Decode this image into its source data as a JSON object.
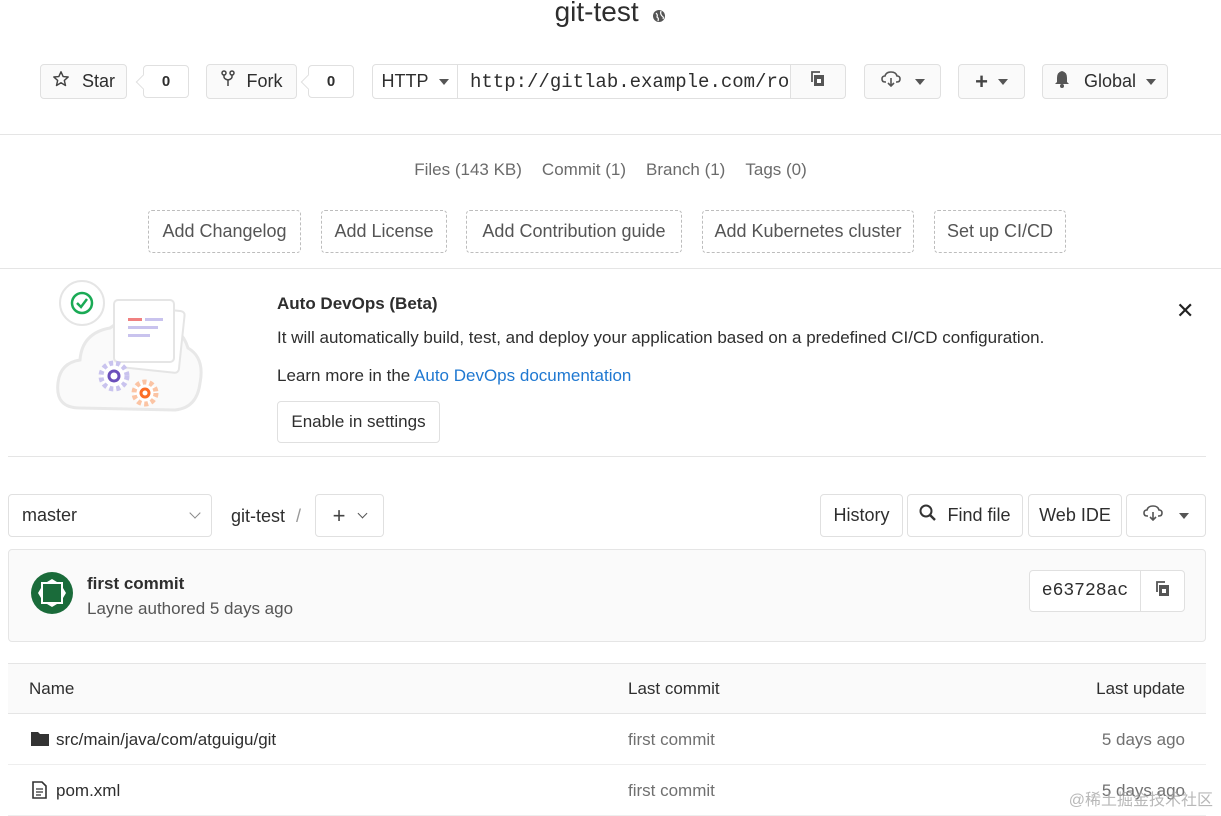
{
  "project": {
    "title": "git-test",
    "visibility_icon": "globe-icon"
  },
  "header": {
    "star_label": "Star",
    "star_count": "0",
    "fork_label": "Fork",
    "fork_count": "0",
    "protocol": "HTTP",
    "clone_url": "http://gitlab.example.com/root/git-test.git",
    "notification_label": "Global"
  },
  "stats": {
    "files": "Files (143 KB)",
    "commits": "Commit (1)",
    "branches": "Branch (1)",
    "tags": "Tags (0)"
  },
  "quick_actions": [
    "Add Changelog",
    "Add License",
    "Add Contribution guide",
    "Add Kubernetes cluster",
    "Set up CI/CD"
  ],
  "devops": {
    "title": "Auto DevOps (Beta)",
    "description": "It will automatically build, test, and deploy your application based on a predefined CI/CD configuration.",
    "learn_prefix": "Learn more in the ",
    "learn_link": "Auto DevOps documentation",
    "enable_button": "Enable in settings"
  },
  "tree": {
    "branch": "master",
    "breadcrumb": "git-test",
    "separator": "/",
    "history": "History",
    "find_file": "Find file",
    "web_ide": "Web IDE"
  },
  "last_commit": {
    "message": "first commit",
    "author_line": "Layne authored 5 days ago",
    "sha": "e63728ac"
  },
  "table": {
    "headers": [
      "Name",
      "Last commit",
      "Last update"
    ],
    "rows": [
      {
        "icon": "folder-icon",
        "name": "src/main/java/com/atguigu/git",
        "commit": "first commit",
        "updated": "5 days ago"
      },
      {
        "icon": "file-icon",
        "name": "pom.xml",
        "commit": "first commit",
        "updated": "5 days ago"
      }
    ]
  },
  "watermark": "@稀土掘金技术社区",
  "colors": {
    "link": "#1f78d1",
    "avatar": "#1a6b3a"
  }
}
